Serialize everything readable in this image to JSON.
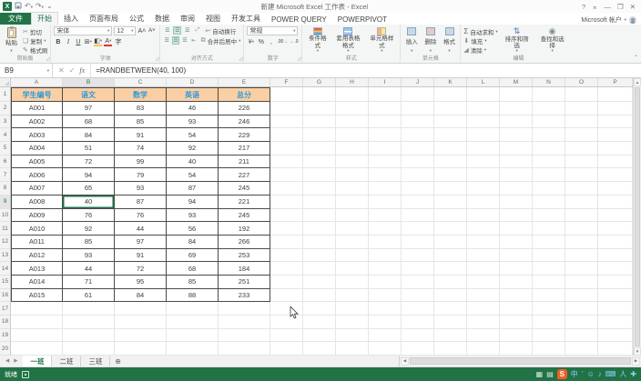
{
  "titlebar": {
    "title": "新建 Microsoft Excel 工作表 - Excel",
    "help": "?",
    "minimize": "—",
    "maximize": "❐",
    "close": "✕"
  },
  "account": {
    "label": "Microsoft 帐户",
    "dropdown": "▾"
  },
  "ribbon_tabs": [
    {
      "label": "文件"
    },
    {
      "label": "开始"
    },
    {
      "label": "插入"
    },
    {
      "label": "页面布局"
    },
    {
      "label": "公式"
    },
    {
      "label": "数据"
    },
    {
      "label": "审阅"
    },
    {
      "label": "视图"
    },
    {
      "label": "开发工具"
    },
    {
      "label": "POWER QUERY"
    },
    {
      "label": "POWERPIVOT"
    }
  ],
  "active_tab": "开始",
  "ribbon": {
    "clipboard": {
      "group": "剪贴板",
      "paste": "粘贴",
      "cut": "剪切",
      "copy": "复制",
      "format_painter": "格式刷"
    },
    "font": {
      "group": "字体",
      "font_name": "宋体",
      "font_size": "12",
      "bold": "B",
      "italic": "I",
      "underline": "U",
      "phonetic": "字"
    },
    "alignment": {
      "group": "对齐方式",
      "wrap_text": "自动换行",
      "merge_center": "合并后居中"
    },
    "number": {
      "group": "数字",
      "format": "常规"
    },
    "styles": {
      "group": "样式",
      "conditional": "条件格式",
      "format_as_table": "套用表格格式",
      "cell_styles": "单元格样式"
    },
    "cells": {
      "group": "单元格",
      "insert": "插入",
      "delete": "删除",
      "format": "格式"
    },
    "editing": {
      "group": "编辑",
      "autosum": "自动求和",
      "fill": "填充",
      "clear": "清除",
      "sort_filter": "排序和筛选",
      "find_select": "查找和选择"
    }
  },
  "formula_bar": {
    "name_box": "B9",
    "formula": "=RANDBETWEEN(40, 100)"
  },
  "grid": {
    "columns": [
      "A",
      "B",
      "C",
      "D",
      "E",
      "F",
      "G",
      "H",
      "I",
      "J",
      "K",
      "L",
      "M",
      "N",
      "O",
      "P"
    ],
    "row_count": 20,
    "selected_cell": {
      "col": "B",
      "row": 9
    },
    "table": {
      "headers": [
        "学生编号",
        "语文",
        "数学",
        "英语",
        "总分"
      ],
      "rows": [
        [
          "A001",
          97,
          83,
          46,
          226
        ],
        [
          "A002",
          68,
          85,
          93,
          246
        ],
        [
          "A003",
          84,
          91,
          54,
          229
        ],
        [
          "A004",
          51,
          74,
          92,
          217
        ],
        [
          "A005",
          72,
          99,
          40,
          211
        ],
        [
          "A006",
          94,
          79,
          54,
          227
        ],
        [
          "A007",
          65,
          93,
          87,
          245
        ],
        [
          "A008",
          40,
          87,
          94,
          221
        ],
        [
          "A009",
          76,
          76,
          93,
          245
        ],
        [
          "A010",
          92,
          44,
          56,
          192
        ],
        [
          "A011",
          85,
          97,
          84,
          266
        ],
        [
          "A012",
          93,
          91,
          69,
          253
        ],
        [
          "A013",
          44,
          72,
          68,
          184
        ],
        [
          "A014",
          71,
          95,
          85,
          251
        ],
        [
          "A015",
          61,
          84,
          88,
          233
        ]
      ]
    }
  },
  "sheet_bar": {
    "tabs": [
      {
        "label": "一班",
        "active": true
      },
      {
        "label": "二班",
        "active": false
      },
      {
        "label": "三班",
        "active": false
      }
    ]
  },
  "status_bar": {
    "ready": "就绪",
    "icons": [
      {
        "name": "sogou-logo-icon",
        "glyph": "S"
      },
      {
        "name": "lang-mode-icon",
        "glyph": "中"
      },
      {
        "name": "punctuation-icon",
        "glyph": "’"
      },
      {
        "name": "emoji-icon",
        "glyph": "☺"
      },
      {
        "name": "voice-icon",
        "glyph": "♪"
      },
      {
        "name": "soft-keyboard-icon",
        "glyph": "⌨"
      },
      {
        "name": "handwriting-icon",
        "glyph": "人"
      },
      {
        "name": "toolbox-icon",
        "glyph": "✚"
      }
    ]
  },
  "colors": {
    "accent_green": "#217346",
    "table_header_bg": "#fbcfa4",
    "table_header_text": "#2e9ad8",
    "sogou_orange": "#f45d22"
  }
}
